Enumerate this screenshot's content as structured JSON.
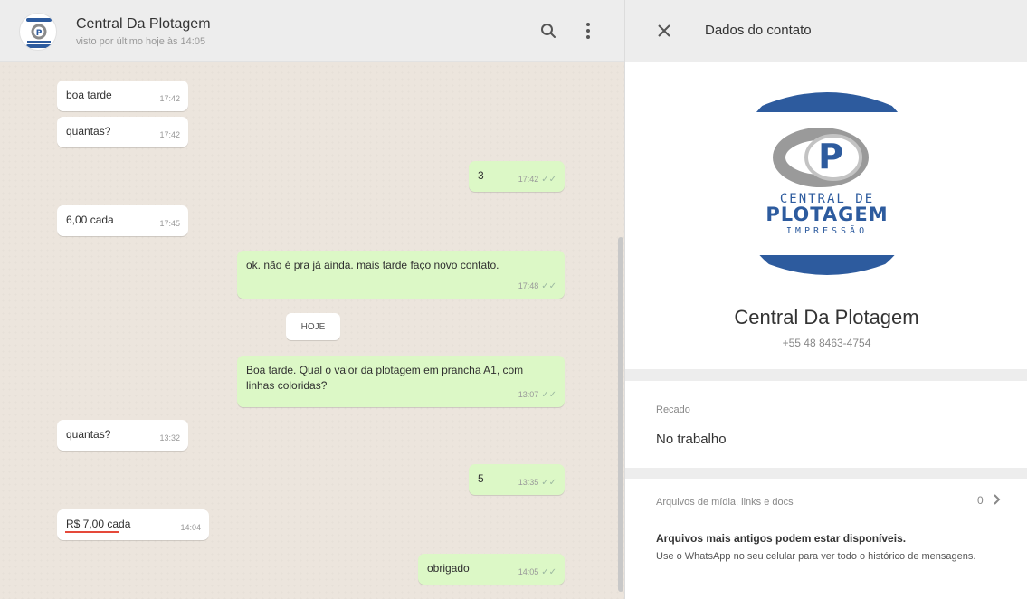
{
  "chat_header": {
    "name": "Central Da Plotagem",
    "status": "visto por último hoje às 14:05"
  },
  "messages": [
    {
      "direction": "in",
      "text": "boa tarde",
      "time": "17:42"
    },
    {
      "direction": "in",
      "text": "quantas?",
      "time": "17:42"
    },
    {
      "direction": "out",
      "text": "3",
      "time": "17:42"
    },
    {
      "direction": "in",
      "text": "6,00 cada",
      "time": "17:45"
    },
    {
      "direction": "out",
      "text": "ok. não é pra já ainda. mais tarde faço novo contato.",
      "time": "17:48"
    },
    {
      "direction": "out",
      "text": "Boa tarde. Qual o valor da plotagem em prancha A1, com linhas coloridas?",
      "time": "13:07"
    },
    {
      "direction": "in",
      "text": "quantas?",
      "time": "13:32"
    },
    {
      "direction": "out",
      "text": "5",
      "time": "13:35"
    },
    {
      "direction": "in",
      "text": "R$ 7,00 cada",
      "time": "14:04"
    },
    {
      "direction": "out",
      "text": "obrigado",
      "time": "14:05"
    }
  ],
  "date_divider": "HOJE",
  "contact_panel": {
    "title": "Dados do contato",
    "name": "Central Da Plotagem",
    "phone": "+55 48 8463-4754",
    "about_label": "Recado",
    "about_value": "No trabalho",
    "media_label": "Arquivos de mídia, links e docs",
    "media_count": "0",
    "older_title": "Arquivos mais antigos podem estar disponíveis.",
    "older_body": "Use o WhatsApp no seu celular para ver todo o histórico de mensagens."
  },
  "logo_text": [
    "CENTRAL DE",
    "PLOTAGEM",
    "IMPRESSÃO"
  ],
  "colors": {
    "outgoing_bubble": "#dcf8c6",
    "incoming_bubble": "#ffffff",
    "chat_background": "#ece5dd",
    "logo_blue": "#2d5b9e",
    "highlight_underline": "#e5493a"
  },
  "icons": [
    "search-icon",
    "menu-dots-icon",
    "close-icon",
    "chevron-right-icon",
    "double-check-icon"
  ]
}
